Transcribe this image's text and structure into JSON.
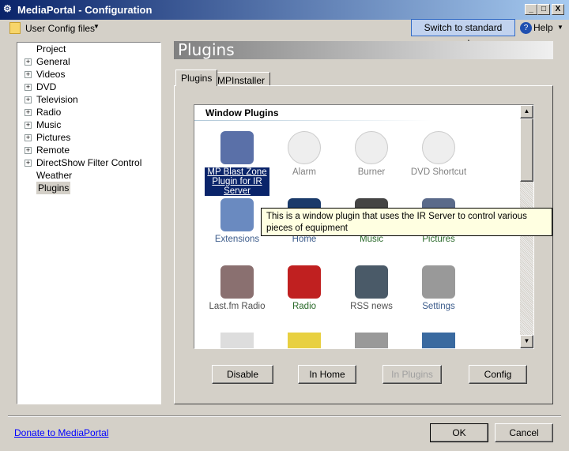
{
  "window": {
    "title": "MediaPortal - Configuration",
    "min": "_",
    "max": "□",
    "close": "X"
  },
  "toolbar": {
    "user_config": "User Config files",
    "switch_mode": "Switch to standard mode",
    "help": "Help"
  },
  "tree": [
    "Project",
    "General",
    "Videos",
    "DVD",
    "Television",
    "Radio",
    "Music",
    "Pictures",
    "Remote",
    "DirectShow Filter Control",
    "Weather",
    "Plugins"
  ],
  "header": "Plugins",
  "tabs": [
    "Plugins",
    "MPInstaller"
  ],
  "list_title": "Window Plugins",
  "plugins": [
    {
      "label": "MP Blast Zone Plugin for IR Server",
      "color": "#ffffff",
      "icon": "#5a70a8"
    },
    {
      "label": "Alarm",
      "color": "#808080",
      "icon": "#eeeeee"
    },
    {
      "label": "Burner",
      "color": "#808080",
      "icon": "#eeeeee"
    },
    {
      "label": "DVD Shortcut",
      "color": "#808080",
      "icon": "#eeeeee"
    },
    {
      "label": "Extensions",
      "color": "#3a5a8a",
      "icon": "#6a8ac0"
    },
    {
      "label": "Home",
      "color": "#3a5a8a",
      "icon": "#1a3a6a"
    },
    {
      "label": "Music",
      "color": "#2a6a2a",
      "icon": "#444444"
    },
    {
      "label": "Pictures",
      "color": "#2a6a2a",
      "icon": "#5a6a8a"
    },
    {
      "label": "Last.fm Radio",
      "color": "#505050",
      "icon": "#8a7070"
    },
    {
      "label": "Radio",
      "color": "#2a6a2a",
      "icon": "#c02020"
    },
    {
      "label": "RSS news",
      "color": "#505050",
      "icon": "#4a5a68"
    },
    {
      "label": "Settings",
      "color": "#3a5a8a",
      "icon": "#999999"
    }
  ],
  "tooltip": "This is a window plugin that uses the IR Server to control various pieces of equipment",
  "buttons": {
    "disable": "Disable",
    "in_home": "In Home",
    "in_plugins": "In Plugins",
    "config": "Config"
  },
  "footer": {
    "donate": "Donate to MediaPortal",
    "ok": "OK",
    "cancel": "Cancel"
  }
}
